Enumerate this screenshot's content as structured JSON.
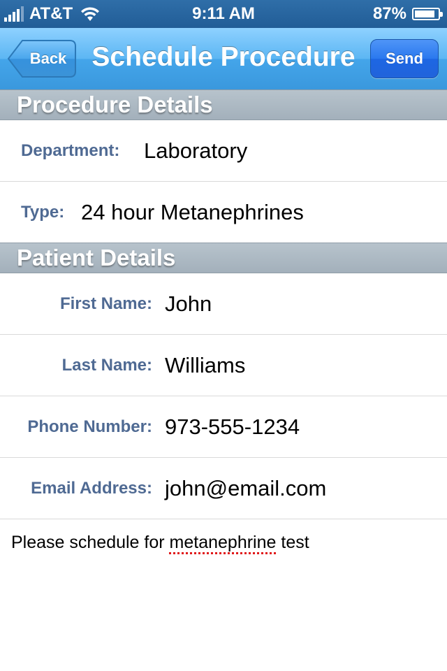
{
  "status_bar": {
    "carrier": "AT&T",
    "time": "9:11 AM",
    "battery_percent_label": "87%",
    "battery_level": 0.87
  },
  "nav": {
    "back_label": "Back",
    "title": "Schedule Procedure",
    "send_label": "Send"
  },
  "sections": {
    "procedure_header": "Procedure Details",
    "patient_header": "Patient Details"
  },
  "procedure": {
    "department_label": "Department:",
    "department_value": "Laboratory",
    "type_label": "Type:",
    "type_value": "24 hour Metanephrines"
  },
  "patient": {
    "first_name_label": "First Name:",
    "first_name_value": "John",
    "last_name_label": "Last Name:",
    "last_name_value": "Williams",
    "phone_label": "Phone Number:",
    "phone_value": "973-555-1234",
    "email_label": "Email Address:",
    "email_value": "john@email.com"
  },
  "notes": {
    "before": "Please schedule for ",
    "misspelled": "metanephrine",
    "after": " test"
  },
  "colors": {
    "nav_accent": "#44a5ea",
    "label_blue": "#4f6a93",
    "send_blue": "#2a78ee"
  }
}
